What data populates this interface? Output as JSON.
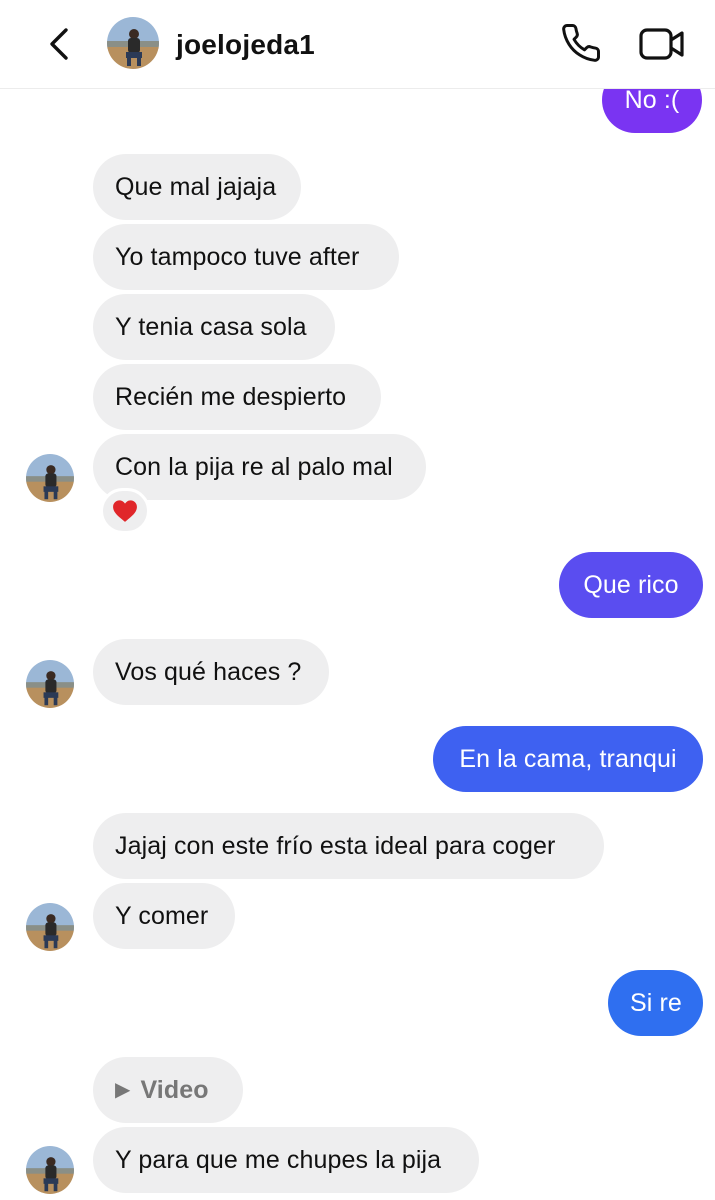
{
  "header": {
    "username": "joelojeda1",
    "icons": [
      "back-chevron-icon",
      "avatar",
      "phone-icon",
      "video-camera-icon"
    ]
  },
  "messages": [
    {
      "from": "me",
      "text": "No :("
    },
    {
      "from": "them",
      "text": "Que mal jajaja"
    },
    {
      "from": "them",
      "text": "Yo tampoco tuve after"
    },
    {
      "from": "them",
      "text": "Y tenia casa sola"
    },
    {
      "from": "them",
      "text": "Recién me despierto"
    },
    {
      "from": "them",
      "text": "Con la pija re al palo mal",
      "reaction": "heart"
    },
    {
      "from": "me",
      "text": "Que rico"
    },
    {
      "from": "them",
      "text": "Vos qué haces ?"
    },
    {
      "from": "me",
      "text": "En la cama, tranqui"
    },
    {
      "from": "them",
      "text": "Jajaj con este frío esta ideal para coger"
    },
    {
      "from": "them",
      "text": "Y comer"
    },
    {
      "from": "me",
      "text": "Si re"
    },
    {
      "from": "them",
      "type": "video",
      "text": "Video"
    },
    {
      "from": "them",
      "text": "Y para que me chupes la pija"
    }
  ],
  "colors": {
    "received_bubble": "#eeeeef",
    "sent_purple": "#7a34f2",
    "sent_indigo": "#5a4df0",
    "sent_blue": "#3e61f1",
    "sent_blue_light": "#2f6ff0",
    "reaction_heart": "#e0262a"
  }
}
